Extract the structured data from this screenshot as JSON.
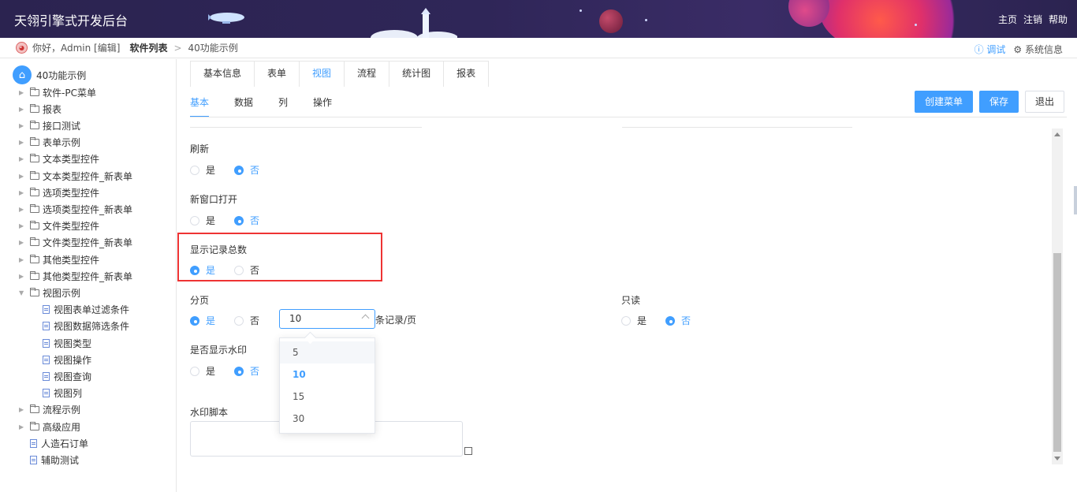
{
  "header": {
    "app_title": "天翎引擎式开发后台",
    "nav": [
      "主页",
      "注销",
      "帮助"
    ]
  },
  "crumbbar": {
    "greeting": "你好，Admin [编辑]",
    "crumb_strong": "软件列表",
    "separator": ">",
    "crumb_current": "40功能示例",
    "debug": "ⓘ 调试",
    "sysinfo": "⚙ 系统信息"
  },
  "sidebar": {
    "root": "40功能示例",
    "items": [
      {
        "label": "软件-PC菜单",
        "type": "folder",
        "level": 0
      },
      {
        "label": "报表",
        "type": "folder",
        "level": 0
      },
      {
        "label": "接口测试",
        "type": "folder",
        "level": 0
      },
      {
        "label": "表单示例",
        "type": "folder",
        "level": 0
      },
      {
        "label": "文本类型控件",
        "type": "folder",
        "level": 0
      },
      {
        "label": "文本类型控件_新表单",
        "type": "folder",
        "level": 0
      },
      {
        "label": "选项类型控件",
        "type": "folder",
        "level": 0
      },
      {
        "label": "选项类型控件_新表单",
        "type": "folder",
        "level": 0
      },
      {
        "label": "文件类型控件",
        "type": "folder",
        "level": 0
      },
      {
        "label": "文件类型控件_新表单",
        "type": "folder",
        "level": 0
      },
      {
        "label": "其他类型控件",
        "type": "folder",
        "level": 0
      },
      {
        "label": "其他类型控件_新表单",
        "type": "folder",
        "level": 0
      },
      {
        "label": "视图示例",
        "type": "folder-open",
        "level": 0
      },
      {
        "label": "视图表单过滤条件",
        "type": "doc",
        "level": 1
      },
      {
        "label": "视图数据筛选条件",
        "type": "doc",
        "level": 1
      },
      {
        "label": "视图类型",
        "type": "doc",
        "level": 1
      },
      {
        "label": "视图操作",
        "type": "doc",
        "level": 1
      },
      {
        "label": "视图查询",
        "type": "doc",
        "level": 1
      },
      {
        "label": "视图列",
        "type": "doc",
        "level": 1
      },
      {
        "label": "流程示例",
        "type": "folder",
        "level": 0
      },
      {
        "label": "高级应用",
        "type": "folder",
        "level": 0
      },
      {
        "label": "人造石订单",
        "type": "doc-top",
        "level": 0
      },
      {
        "label": "辅助测试",
        "type": "doc-top",
        "level": 0
      }
    ]
  },
  "top_tabs": [
    "基本信息",
    "表单",
    "视图",
    "流程",
    "统计图",
    "报表"
  ],
  "top_tab_active": 2,
  "sub_tabs": [
    "基本",
    "数据",
    "列",
    "操作"
  ],
  "sub_tab_active": 0,
  "actions": {
    "create_menu": "创建菜单",
    "save": "保存",
    "exit": "退出"
  },
  "form": {
    "refresh": {
      "label": "刷新",
      "yes": "是",
      "no": "否",
      "selected": "no"
    },
    "new_window": {
      "label": "新窗口打开",
      "yes": "是",
      "no": "否",
      "selected": "no"
    },
    "show_total": {
      "label": "显示记录总数",
      "yes": "是",
      "no": "否",
      "selected": "yes"
    },
    "paging": {
      "label": "分页",
      "yes": "是",
      "no": "否",
      "selected": "yes",
      "page_size": "10",
      "suffix": "条记录/页"
    },
    "readonly": {
      "label": "只读",
      "yes": "是",
      "no": "否",
      "selected": "no"
    },
    "watermark": {
      "label": "是否显示水印",
      "yes": "是",
      "no": "否",
      "selected": "no"
    },
    "watermark_script": {
      "label": "水印脚本",
      "value": ""
    }
  },
  "page_size_options": [
    "5",
    "10",
    "15",
    "30"
  ],
  "page_size_selected": "10",
  "colors": {
    "accent": "#409eff",
    "highlight": "#ee3333"
  }
}
